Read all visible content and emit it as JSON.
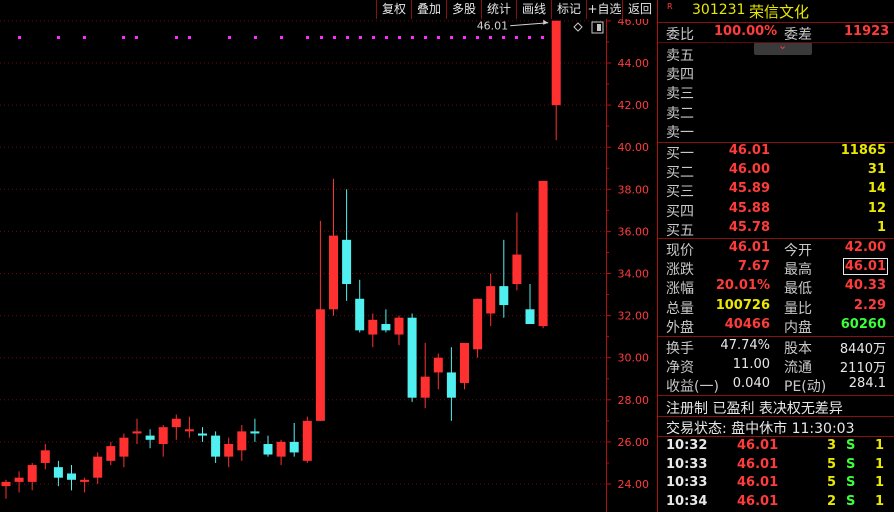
{
  "toolbar": {
    "buttons": [
      "复权",
      "叠加",
      "多股",
      "统计",
      "画线",
      "标记",
      "+自选",
      "返回"
    ]
  },
  "chart_data": {
    "type": "candlestick",
    "y_ticks": [
      "46.00",
      "44.00",
      "42.00",
      "40.00",
      "38.00",
      "36.00",
      "34.00",
      "32.00",
      "30.00",
      "28.00",
      "26.00",
      "24.00"
    ],
    "ylim": [
      23.75,
      46.7
    ],
    "annotation": "46.01",
    "annotation_value": 46.01,
    "candles": [
      {
        "o": 23.9,
        "h": 24.2,
        "l": 23.3,
        "c": 24.1
      },
      {
        "o": 24.1,
        "h": 24.6,
        "l": 23.6,
        "c": 24.3
      },
      {
        "o": 24.1,
        "h": 25.0,
        "l": 23.7,
        "c": 24.9
      },
      {
        "o": 25.0,
        "h": 25.9,
        "l": 24.7,
        "c": 25.6
      },
      {
        "o": 24.8,
        "h": 25.1,
        "l": 23.9,
        "c": 24.3
      },
      {
        "o": 24.5,
        "h": 24.9,
        "l": 23.7,
        "c": 24.2
      },
      {
        "o": 24.1,
        "h": 24.3,
        "l": 23.6,
        "c": 24.2
      },
      {
        "o": 24.3,
        "h": 25.5,
        "l": 24.0,
        "c": 25.3
      },
      {
        "o": 25.1,
        "h": 26.0,
        "l": 24.9,
        "c": 25.8
      },
      {
        "o": 25.3,
        "h": 26.4,
        "l": 24.8,
        "c": 26.2
      },
      {
        "o": 26.4,
        "h": 27.1,
        "l": 25.9,
        "c": 26.5
      },
      {
        "o": 26.3,
        "h": 26.6,
        "l": 25.7,
        "c": 26.1
      },
      {
        "o": 25.9,
        "h": 26.8,
        "l": 25.3,
        "c": 26.7
      },
      {
        "o": 26.7,
        "h": 27.3,
        "l": 26.1,
        "c": 27.1
      },
      {
        "o": 26.5,
        "h": 27.2,
        "l": 26.2,
        "c": 26.6
      },
      {
        "o": 26.4,
        "h": 26.7,
        "l": 26.0,
        "c": 26.3
      },
      {
        "o": 26.3,
        "h": 26.5,
        "l": 25.0,
        "c": 25.3
      },
      {
        "o": 25.3,
        "h": 26.2,
        "l": 24.8,
        "c": 25.9
      },
      {
        "o": 25.6,
        "h": 26.8,
        "l": 25.1,
        "c": 26.5
      },
      {
        "o": 26.5,
        "h": 27.1,
        "l": 26.0,
        "c": 26.4
      },
      {
        "o": 25.9,
        "h": 26.3,
        "l": 25.3,
        "c": 25.4
      },
      {
        "o": 25.3,
        "h": 26.1,
        "l": 24.9,
        "c": 26.0
      },
      {
        "o": 26.0,
        "h": 26.9,
        "l": 25.3,
        "c": 25.5
      },
      {
        "o": 25.1,
        "h": 27.2,
        "l": 25.0,
        "c": 27.0
      },
      {
        "o": 27.0,
        "h": 36.5,
        "l": 27.0,
        "c": 32.3
      },
      {
        "o": 32.3,
        "h": 38.5,
        "l": 32.0,
        "c": 35.8
      },
      {
        "o": 35.6,
        "h": 38.0,
        "l": 32.7,
        "c": 33.5
      },
      {
        "o": 32.8,
        "h": 33.7,
        "l": 31.2,
        "c": 31.3
      },
      {
        "o": 31.1,
        "h": 32.1,
        "l": 30.5,
        "c": 31.8
      },
      {
        "o": 31.6,
        "h": 32.3,
        "l": 31.2,
        "c": 31.3
      },
      {
        "o": 31.1,
        "h": 32.0,
        "l": 30.6,
        "c": 31.9
      },
      {
        "o": 31.9,
        "h": 32.1,
        "l": 27.9,
        "c": 28.1
      },
      {
        "o": 28.1,
        "h": 30.7,
        "l": 27.6,
        "c": 29.1
      },
      {
        "o": 29.3,
        "h": 30.2,
        "l": 28.5,
        "c": 30.0
      },
      {
        "o": 29.3,
        "h": 30.5,
        "l": 27.0,
        "c": 28.1
      },
      {
        "o": 28.8,
        "h": 30.7,
        "l": 28.5,
        "c": 30.7
      },
      {
        "o": 30.4,
        "h": 32.8,
        "l": 30.0,
        "c": 32.8
      },
      {
        "o": 32.1,
        "h": 34.0,
        "l": 31.5,
        "c": 33.4
      },
      {
        "o": 33.4,
        "h": 35.6,
        "l": 31.9,
        "c": 32.5
      },
      {
        "o": 33.5,
        "h": 36.9,
        "l": 33.2,
        "c": 34.9
      },
      {
        "o": 32.3,
        "h": 33.5,
        "l": 31.8,
        "c": 31.6
      },
      {
        "o": 31.5,
        "h": 38.4,
        "l": 31.4,
        "c": 38.4
      },
      {
        "o": 42.0,
        "h": 46.01,
        "l": 40.33,
        "c": 46.01
      }
    ]
  },
  "panel": {
    "stock_code": "301231",
    "stock_name": "荣信文化",
    "flag": "R",
    "weibi_label": "委比",
    "weibi_value": "100.00%",
    "weicha_label": "委差",
    "weicha_value": "11923",
    "sell": [
      {
        "label": "卖五",
        "price": "",
        "vol": ""
      },
      {
        "label": "卖四",
        "price": "",
        "vol": ""
      },
      {
        "label": "卖三",
        "price": "",
        "vol": ""
      },
      {
        "label": "卖二",
        "price": "",
        "vol": ""
      },
      {
        "label": "卖一",
        "price": "",
        "vol": ""
      }
    ],
    "buy": [
      {
        "label": "买一",
        "price": "46.01",
        "vol": "11865"
      },
      {
        "label": "买二",
        "price": "46.00",
        "vol": "31"
      },
      {
        "label": "买三",
        "price": "45.89",
        "vol": "14"
      },
      {
        "label": "买四",
        "price": "45.88",
        "vol": "12"
      },
      {
        "label": "买五",
        "price": "45.78",
        "vol": "1"
      }
    ],
    "stats": [
      {
        "l1": "现价",
        "v1": "46.01",
        "c1": "red",
        "l2": "今开",
        "v2": "42.00",
        "c2": "red"
      },
      {
        "l1": "涨跌",
        "v1": "7.67",
        "c1": "red",
        "l2": "最高",
        "v2": "46.01",
        "c2": "red"
      },
      {
        "l1": "涨幅",
        "v1": "20.01%",
        "c1": "red",
        "l2": "最低",
        "v2": "40.33",
        "c2": "red"
      },
      {
        "l1": "总量",
        "v1": "100726",
        "c1": "yellow",
        "l2": "量比",
        "v2": "2.29",
        "c2": "red"
      },
      {
        "l1": "外盘",
        "v1": "40466",
        "c1": "red",
        "l2": "内盘",
        "v2": "60260",
        "c2": "green"
      }
    ],
    "stats2": [
      {
        "l1": "换手",
        "v1": "47.74%",
        "l2": "股本",
        "v2": "8440万"
      },
      {
        "l1": "净资",
        "v1": "11.00",
        "l2": "流通",
        "v2": "2110万"
      },
      {
        "l1": "收益(一)",
        "v1": "0.040",
        "l2": "PE(动)",
        "v2": "284.1"
      }
    ],
    "tags": "注册制 已盈利 表决权无差异",
    "status": "交易状态: 盘中休市 11:30:03",
    "ticks": [
      {
        "time": "10:32",
        "price": "46.01",
        "vol": "3",
        "side": "S",
        "n": "1"
      },
      {
        "time": "10:33",
        "price": "46.01",
        "vol": "5",
        "side": "S",
        "n": "1"
      },
      {
        "time": "10:33",
        "price": "46.01",
        "vol": "5",
        "side": "S",
        "n": "1"
      },
      {
        "time": "10:34",
        "price": "46.01",
        "vol": "2",
        "side": "S",
        "n": "1"
      }
    ]
  }
}
